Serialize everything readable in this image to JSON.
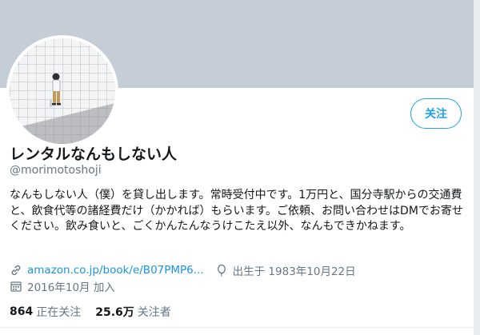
{
  "profile": {
    "name": "レンタルなんもしない人",
    "handle": "@morimotoshoji",
    "bio": "なんもしない人（僕）を貸し出します。常時受付中です。1万円と、国分寺駅からの交通費と、飲食代等の諸経費だけ（かかれば）もらいます。ご依頼、お問い合わせはDMでお寄せください。飲み食いと、ごくかんたんなうけこたえ以外、なんもできかねます。",
    "follow_label": "关注",
    "link": "amazon.co.jp/book/e/B07PMP6...",
    "birthday": "出生于 1983年10月22日",
    "joined": "2016年10月 加入"
  },
  "stats": {
    "following_count": "864",
    "following_label": "正在关注",
    "followers_count": "25.6万",
    "followers_label": "关注者"
  },
  "colors": {
    "accent": "#1da1f2",
    "banner": "#c5ced6",
    "secondary_text": "#657786"
  },
  "icons": {
    "link": "link-icon",
    "birthday": "balloon-icon",
    "joined": "calendar-icon"
  }
}
